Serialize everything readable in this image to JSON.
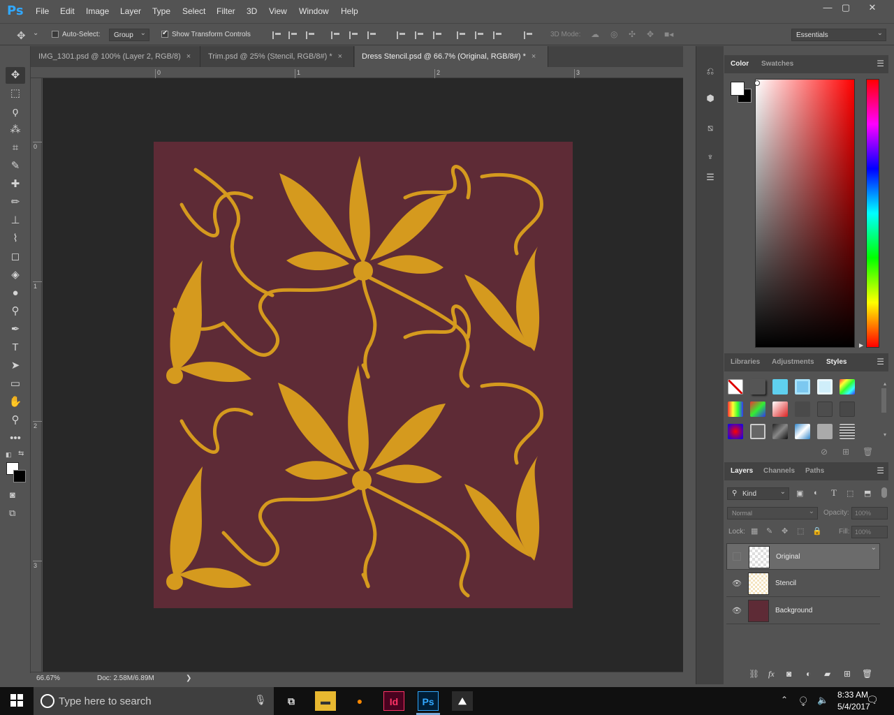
{
  "app": {
    "logo": "Ps"
  },
  "menu": [
    "File",
    "Edit",
    "Image",
    "Layer",
    "Type",
    "Select",
    "Filter",
    "3D",
    "View",
    "Window",
    "Help"
  ],
  "window_controls": {
    "minimize": "—",
    "restore": "▢",
    "close": "✕"
  },
  "options": {
    "auto_select_label": "Auto-Select:",
    "auto_select_checked": false,
    "group_value": "Group",
    "show_transform_label": "Show Transform Controls",
    "show_transform_checked": true,
    "mode_3d_label": "3D Mode:",
    "workspace_value": "Essentials"
  },
  "tabs": [
    {
      "label": "IMG_1301.psd @ 100% (Layer 2, RGB/8)",
      "active": false
    },
    {
      "label": "Trim.psd @ 25% (Stencil, RGB/8#) *",
      "active": false
    },
    {
      "label": "Dress Stencil.psd @ 66.7% (Original, RGB/8#) *",
      "active": true
    }
  ],
  "tab_close": "×",
  "ruler": {
    "top_labels": [
      "0",
      "1",
      "2",
      "3"
    ],
    "left_labels": [
      "0",
      "1",
      "2",
      "3"
    ]
  },
  "tools": [
    "move-tool",
    "marquee-tool",
    "lasso-tool",
    "quick-select-tool",
    "crop-tool",
    "eyedropper-tool",
    "healing-brush-tool",
    "brush-tool",
    "clone-stamp-tool",
    "history-brush-tool",
    "eraser-tool",
    "paint-bucket-tool",
    "blur-tool",
    "dodge-tool",
    "pen-tool",
    "type-tool",
    "path-selection-tool",
    "rectangle-tool",
    "hand-tool",
    "zoom-tool",
    "edit-toolbar"
  ],
  "tool_glyphs": [
    "✥",
    "⬚",
    "ϙ",
    "⁂",
    "⌗",
    "✎",
    "✚",
    "✏",
    "⊥",
    "⌇",
    "◻",
    "◈",
    "●",
    "⚲",
    "✒",
    "T",
    "➤",
    "▭",
    "✋",
    "⚲",
    "•••"
  ],
  "colors": {
    "foreground": "#ffffff",
    "background": "#000000",
    "artboard": "#5e2b36",
    "stencil_gold": "#d59a1e"
  },
  "status": {
    "zoom": "66.67%",
    "doc": "Doc: 2.58M/6.89M",
    "arrow": "❯"
  },
  "color_panel": {
    "tabs": [
      "Color",
      "Swatches"
    ],
    "active": "Color"
  },
  "styles_panel": {
    "tabs": [
      "Libraries",
      "Adjustments",
      "Styles"
    ],
    "active": "Styles"
  },
  "layers_panel": {
    "tabs": [
      "Layers",
      "Channels",
      "Paths"
    ],
    "active": "Layers",
    "kind_filter": "Kind",
    "blend_mode": "Normal",
    "opacity_label": "Opacity:",
    "opacity_value": "100%",
    "lock_label": "Lock:",
    "fill_label": "Fill:",
    "fill_value": "100%",
    "layers": [
      {
        "name": "Original",
        "visible": false,
        "selected": true
      },
      {
        "name": "Stencil",
        "visible": true,
        "selected": false
      },
      {
        "name": "Background",
        "visible": true,
        "selected": false
      }
    ],
    "footer_icons": [
      "link-icon",
      "fx-icon",
      "mask-icon",
      "adjustment-icon",
      "folder-icon",
      "new-layer-icon",
      "trash-icon"
    ],
    "footer_glyphs": [
      "⛓",
      "fx",
      "◙",
      "◐",
      "▰",
      "⊞",
      "🗑"
    ]
  },
  "taskbar": {
    "search_placeholder": "Type here to search",
    "time": "8:33 AM",
    "date": "5/4/2017",
    "apps": [
      "Id",
      "Ps"
    ]
  }
}
